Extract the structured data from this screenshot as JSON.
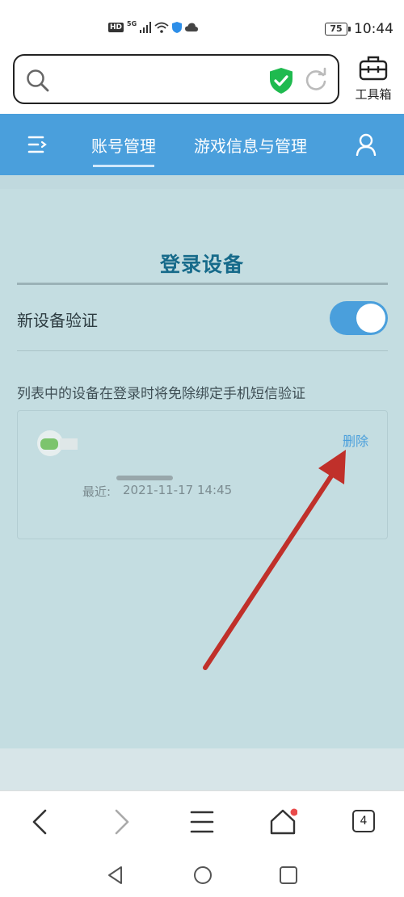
{
  "status_bar": {
    "hd": "HD",
    "network": "5G",
    "battery": "75",
    "time": "10:44"
  },
  "search": {
    "placeholder": ""
  },
  "toolbox": {
    "label": "工具箱"
  },
  "nav": {
    "tabs": [
      {
        "label": "账号管理",
        "active": true
      },
      {
        "label": "游戏信息与管理",
        "active": false
      }
    ]
  },
  "section": {
    "title": "登录设备",
    "setting_label": "新设备验证",
    "setting_enabled": true,
    "hint": "列表中的设备在登录时将免除绑定手机短信验证"
  },
  "device": {
    "delete_label": "删除",
    "recent_label": "最近:",
    "recent_time": "2021-11-17 14:45"
  },
  "bottom_bar": {
    "tab_count": "4"
  },
  "colors": {
    "nav_blue": "#4a9fdc",
    "content_bg": "#c4dde1",
    "title_teal": "#166a8a",
    "annotation_red": "#c0302a"
  }
}
